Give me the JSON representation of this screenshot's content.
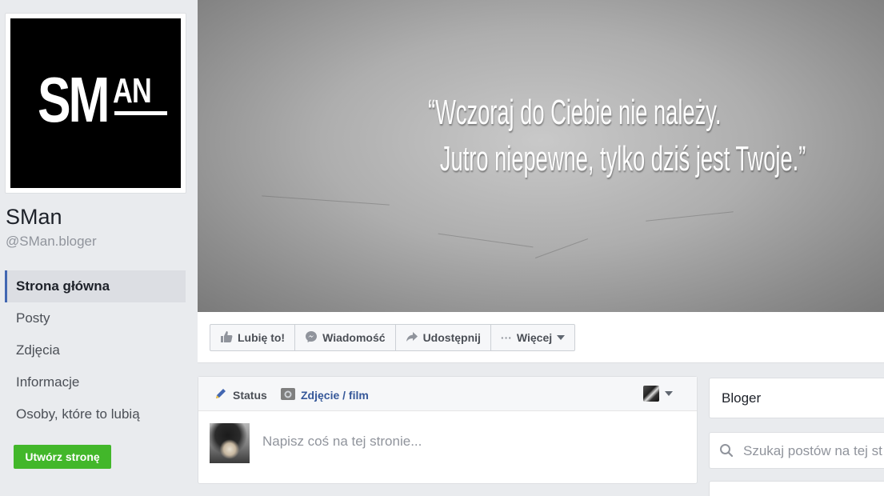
{
  "page": {
    "logo_text": "SM",
    "logo_sup": "AN",
    "name": "SMan",
    "handle": "@SMan.bloger"
  },
  "nav": {
    "items": [
      {
        "label": "Strona główna",
        "active": true
      },
      {
        "label": "Posty"
      },
      {
        "label": "Zdjęcia"
      },
      {
        "label": "Informacje"
      },
      {
        "label": "Osoby, które to lubią"
      }
    ],
    "create_page_label": "Utwórz stronę"
  },
  "cover": {
    "quote_line1": "“Wczoraj do Ciebie nie należy.",
    "quote_line2": "Jutro niepewne, tylko dziś jest Twoje.”"
  },
  "actions": {
    "like_label": "Lubię to!",
    "message_label": "Wiadomość",
    "share_label": "Udostępnij",
    "more_label": "Więcej",
    "more_dots": "···"
  },
  "composer": {
    "status_label": "Status",
    "photo_label": "Zdjęcie / film",
    "placeholder": "Napisz coś na tej stronie..."
  },
  "sidebar": {
    "category": "Bloger",
    "search_placeholder": "Szukaj postów na tej st"
  },
  "colors": {
    "brand_blue": "#4267b2",
    "link_blue": "#365899",
    "create_green": "#42b72a",
    "background": "#e9ebee"
  },
  "icons": [
    "thumbs-up-icon",
    "messenger-icon",
    "share-icon",
    "more-dots-icon",
    "pencil-icon",
    "camera-icon",
    "search-icon",
    "caret-down-icon"
  ]
}
